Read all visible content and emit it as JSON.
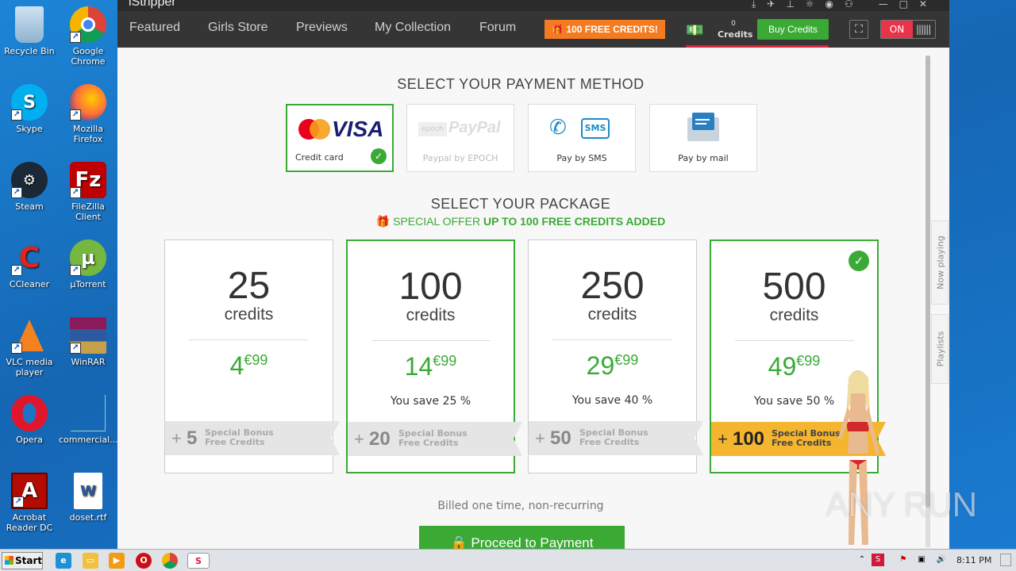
{
  "desktop": {
    "icons": [
      {
        "label": "Recycle Bin",
        "icon": "recycle-bin-icon"
      },
      {
        "label": "Google Chrome",
        "icon": "chrome-icon"
      },
      {
        "label": "Skype",
        "icon": "skype-icon"
      },
      {
        "label": "Mozilla Firefox",
        "icon": "firefox-icon"
      },
      {
        "label": "Steam",
        "icon": "steam-icon"
      },
      {
        "label": "FileZilla Client",
        "icon": "filezilla-icon"
      },
      {
        "label": "CCleaner",
        "icon": "ccleaner-icon"
      },
      {
        "label": "µTorrent",
        "icon": "utorrent-icon"
      },
      {
        "label": "VLC media player",
        "icon": "vlc-icon"
      },
      {
        "label": "WinRAR",
        "icon": "winrar-icon"
      },
      {
        "label": "Opera",
        "icon": "opera-icon"
      },
      {
        "label": "commercial...",
        "icon": "blank-file-icon"
      },
      {
        "label": "Acrobat Reader DC",
        "icon": "acrobat-icon"
      },
      {
        "label": "doset.rtf",
        "icon": "word-document-icon"
      }
    ]
  },
  "app": {
    "brand": "iStripper",
    "nav": [
      "Featured",
      "Girls Store",
      "Previews",
      "My Collection",
      "Forum"
    ],
    "free_credits_button": "100 FREE CREDITS!",
    "credits_count": "0",
    "credits_label": "Credits",
    "buy_credits_button": "Buy Credits",
    "toggle_label": "ON"
  },
  "payment": {
    "title": "SELECT YOUR PAYMENT METHOD",
    "methods": [
      {
        "label": "Credit card",
        "logo_a": "mastercard",
        "logo_b": "VISA",
        "selected": true
      },
      {
        "label": "Paypal by EPOCH",
        "logo_a": "epoch",
        "logo_b": "PayPal",
        "disabled": true
      },
      {
        "label": "Pay by SMS",
        "logo_b": "SMS"
      },
      {
        "label": "Pay by mail"
      }
    ]
  },
  "package": {
    "title": "SELECT YOUR PACKAGE",
    "offer_prefix": "SPECIAL OFFER",
    "offer_highlight": "UP TO 100 FREE CREDITS ADDED",
    "unit": "credits",
    "bonus_line1": "Special Bonus",
    "bonus_line2": "Free Credits",
    "items": [
      {
        "amount": "25",
        "price_main": "4",
        "price_cents": "€99",
        "save": "",
        "bonus": "5",
        "selected": false
      },
      {
        "amount": "100",
        "price_main": "14",
        "price_cents": "€99",
        "save": "You save 25 %",
        "bonus": "20",
        "selected": true
      },
      {
        "amount": "250",
        "price_main": "29",
        "price_cents": "€99",
        "save": "You save 40 %",
        "bonus": "50",
        "selected": false
      },
      {
        "amount": "500",
        "price_main": "49",
        "price_cents": "€99",
        "save": "You save 50 %",
        "bonus": "100",
        "selected": true
      }
    ]
  },
  "footer": {
    "billed": "Billed one time, non-recurring",
    "proceed_button": "Proceed to Payment"
  },
  "side_tabs": [
    "Now playing",
    "Playlists"
  ],
  "watermark": "ANY RUN",
  "taskbar": {
    "start": "Start",
    "clock": "8:11 PM"
  }
}
